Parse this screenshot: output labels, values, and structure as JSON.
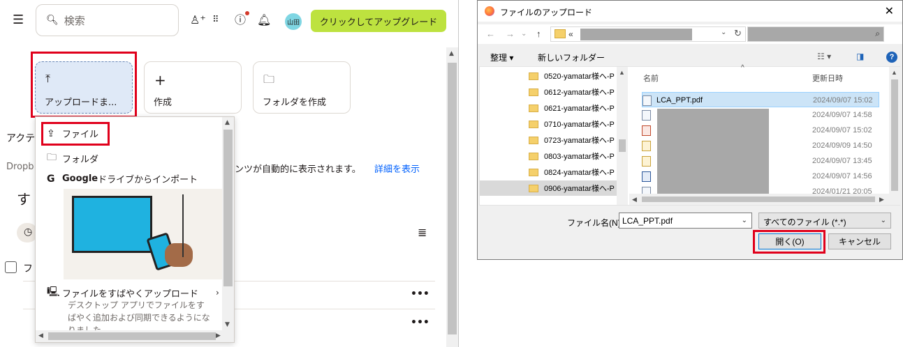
{
  "web": {
    "search_placeholder": "検索",
    "avatar_text": "山田",
    "upgrade_label": "クリックしてアップグレード",
    "tiles": {
      "upload": "アップロードま...",
      "create": "作成",
      "folder": "フォルダを作成"
    },
    "menu": {
      "file": "ファイル",
      "folder": "フォルダ",
      "google_brand": "Google",
      "google_rest": " ドライブからインポート",
      "fast_upload_title": "ファイルをすばやくアップロード",
      "fast_upload_desc1": "デスクトップ アプリでファイルをす",
      "fast_upload_desc2": "ばやく追加および同期できるようにな",
      "fast_upload_desc3": "りました"
    },
    "background": {
      "activity_partial": "アクテ",
      "dropbox_partial": "Dropb",
      "auto_text_partial": "ンツが自動的に表示されます。",
      "details_link": "詳細を表示",
      "all_partial": "す",
      "row_partial": "フ"
    },
    "colors": {
      "accent_green": "#bde23f",
      "link_blue": "#0061fe",
      "highlight_red": "#e0001b"
    }
  },
  "dialog": {
    "title": "ファイルのアップロード",
    "address_prefix": "«",
    "organize": "整理 ▾",
    "new_folder": "新しいフォルダー",
    "col_name": "名前",
    "col_date": "更新日時",
    "tree_items": [
      "0520-yamatar様へ-P",
      "0612-yamatar様へ-P",
      "0621-yamatar様へ-P",
      "0710-yamatar様へ-P",
      "0723-yamatar様へ-P",
      "0803-yamatar様へ-P",
      "0824-yamatar様へ-P",
      "0906-yamatar様へ-P"
    ],
    "files": [
      {
        "name": "LCA_PPT.pdf",
        "date": "2024/09/07 15:02"
      },
      {
        "name": "",
        "date": "2024/09/07 14:58"
      },
      {
        "name": "",
        "date": "2024/09/07 15:02"
      },
      {
        "name": "",
        "date": "2024/09/09 14:50"
      },
      {
        "name": "",
        "date": "2024/09/07 13:45"
      },
      {
        "name": "",
        "date": "2024/09/07 14:56"
      },
      {
        "name": "",
        "date": "2024/01/21 20:05"
      }
    ],
    "filename_label": "ファイル名(N):",
    "filename_value": "LCA_PPT.pdf",
    "filetype_value": "すべてのファイル (*.*)",
    "open_label": "開く(O)",
    "cancel_label": "キャンセル"
  }
}
